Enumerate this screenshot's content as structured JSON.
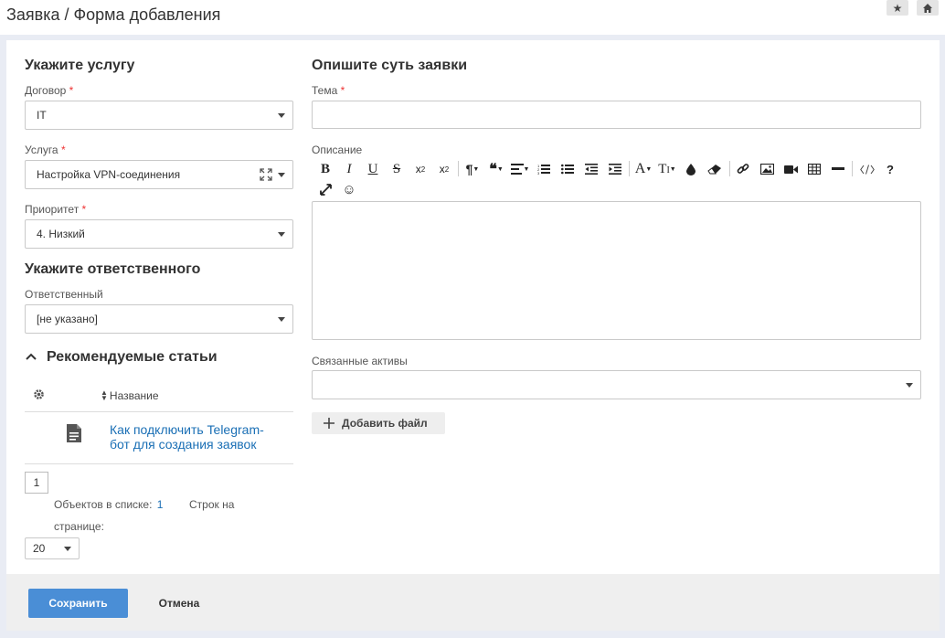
{
  "header": {
    "title": "Заявка / Форма добавления",
    "star_icon": "star-icon",
    "home_icon": "home-icon"
  },
  "service_section": {
    "title": "Укажите услугу",
    "contract_label": "Договор",
    "contract_value": "IT",
    "service_label": "Услуга",
    "service_value": "Настройка VPN-соединения",
    "priority_label": "Приоритет",
    "priority_value": "4. Низкий",
    "required_mark": "*"
  },
  "responsible_section": {
    "title": "Укажите ответственного",
    "responsible_label": "Ответственный",
    "responsible_value": "[не указано]"
  },
  "articles": {
    "title": "Рекомендуемые статьи",
    "col_name": "Название",
    "rows": [
      {
        "title_line1": "Как подключить Telegram-",
        "title_line2": "бот для создания заявок"
      }
    ],
    "page": "1",
    "count_label": "Объектов в списке:",
    "count_value": "1",
    "rows_label_1": "Строк на",
    "rows_label_2": "странице:",
    "page_size": "20"
  },
  "description_section": {
    "title": "Опишите суть заявки",
    "subject_label": "Тема",
    "description_label": "Описание",
    "assets_label": "Связанные активы",
    "add_file_label": "Добавить файл"
  },
  "footer": {
    "save_label": "Сохранить",
    "cancel_label": "Отмена"
  },
  "colors": {
    "primary": "#4a8ed6",
    "link": "#1a6fb5",
    "required": "#e33333",
    "background": "#e9ecf4"
  }
}
